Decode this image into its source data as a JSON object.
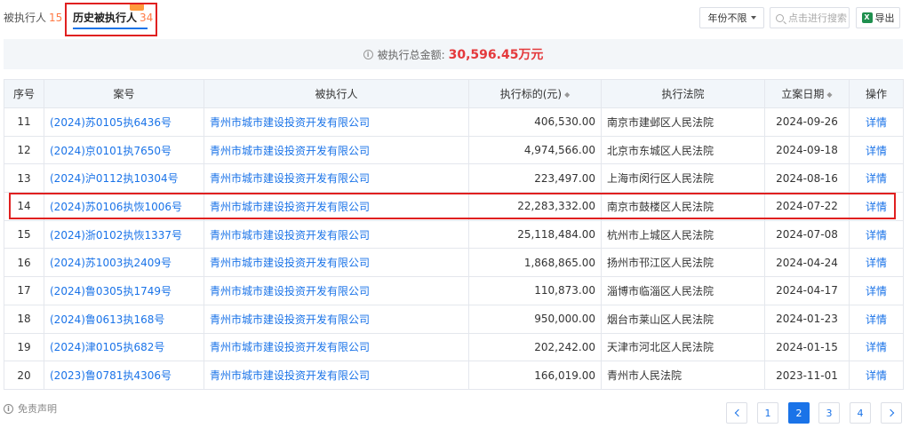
{
  "tabs": [
    {
      "label": "被执行人",
      "count": "15"
    },
    {
      "label": "历史被执行人",
      "count": "34"
    }
  ],
  "toolbar": {
    "year_filter": "年份不限",
    "search_placeholder": "点击进行搜索",
    "export_label": "导出",
    "export_icon": "excel-icon",
    "excel_glyph": "X"
  },
  "summary": {
    "label": "被执行总金额:",
    "amount": "30,596.45万元",
    "info_glyph": "i"
  },
  "table": {
    "headers": [
      "序号",
      "案号",
      "被执行人",
      "执行标的(元)",
      "执行法院",
      "立案日期",
      "操作"
    ],
    "sort_glyph": "◆",
    "rows": [
      {
        "no": "11",
        "case": "(2024)苏0105执6436号",
        "executed": "青州市城市建设投资开发有限公司",
        "amount": "406,530.00",
        "court": "南京市建邺区人民法院",
        "date": "2024-09-26",
        "op": "详情"
      },
      {
        "no": "12",
        "case": "(2024)京0101执7650号",
        "executed": "青州市城市建设投资开发有限公司",
        "amount": "4,974,566.00",
        "court": "北京市东城区人民法院",
        "date": "2024-09-18",
        "op": "详情"
      },
      {
        "no": "13",
        "case": "(2024)沪0112执10304号",
        "executed": "青州市城市建设投资开发有限公司",
        "amount": "223,497.00",
        "court": "上海市闵行区人民法院",
        "date": "2024-08-16",
        "op": "详情"
      },
      {
        "no": "14",
        "case": "(2024)苏0106执恢1006号",
        "executed": "青州市城市建设投资开发有限公司",
        "amount": "22,283,332.00",
        "court": "南京市鼓楼区人民法院",
        "date": "2024-07-22",
        "op": "详情"
      },
      {
        "no": "15",
        "case": "(2024)浙0102执恢1337号",
        "executed": "青州市城市建设投资开发有限公司",
        "amount": "25,118,484.00",
        "court": "杭州市上城区人民法院",
        "date": "2024-07-08",
        "op": "详情"
      },
      {
        "no": "16",
        "case": "(2024)苏1003执2409号",
        "executed": "青州市城市建设投资开发有限公司",
        "amount": "1,868,865.00",
        "court": "扬州市邗江区人民法院",
        "date": "2024-04-24",
        "op": "详情"
      },
      {
        "no": "17",
        "case": "(2024)鲁0305执1749号",
        "executed": "青州市城市建设投资开发有限公司",
        "amount": "110,873.00",
        "court": "淄博市临淄区人民法院",
        "date": "2024-04-17",
        "op": "详情"
      },
      {
        "no": "18",
        "case": "(2024)鲁0613执168号",
        "executed": "青州市城市建设投资开发有限公司",
        "amount": "950,000.00",
        "court": "烟台市莱山区人民法院",
        "date": "2024-01-23",
        "op": "详情"
      },
      {
        "no": "19",
        "case": "(2024)津0105执682号",
        "executed": "青州市城市建设投资开发有限公司",
        "amount": "202,242.00",
        "court": "天津市河北区人民法院",
        "date": "2024-01-15",
        "op": "详情"
      },
      {
        "no": "20",
        "case": "(2023)鲁0781执4306号",
        "executed": "青州市城市建设投资开发有限公司",
        "amount": "166,019.00",
        "court": "青州市人民法院",
        "date": "2023-11-01",
        "op": "详情"
      }
    ]
  },
  "footer": {
    "disclaimer": "免责声明",
    "pages": [
      "1",
      "2",
      "3",
      "4"
    ],
    "current_page": "2"
  },
  "colors": {
    "accent": "#1a73e8",
    "amount_red": "#e4393c",
    "highlight_red": "#e02020",
    "count_orange": "#ff7a45"
  }
}
